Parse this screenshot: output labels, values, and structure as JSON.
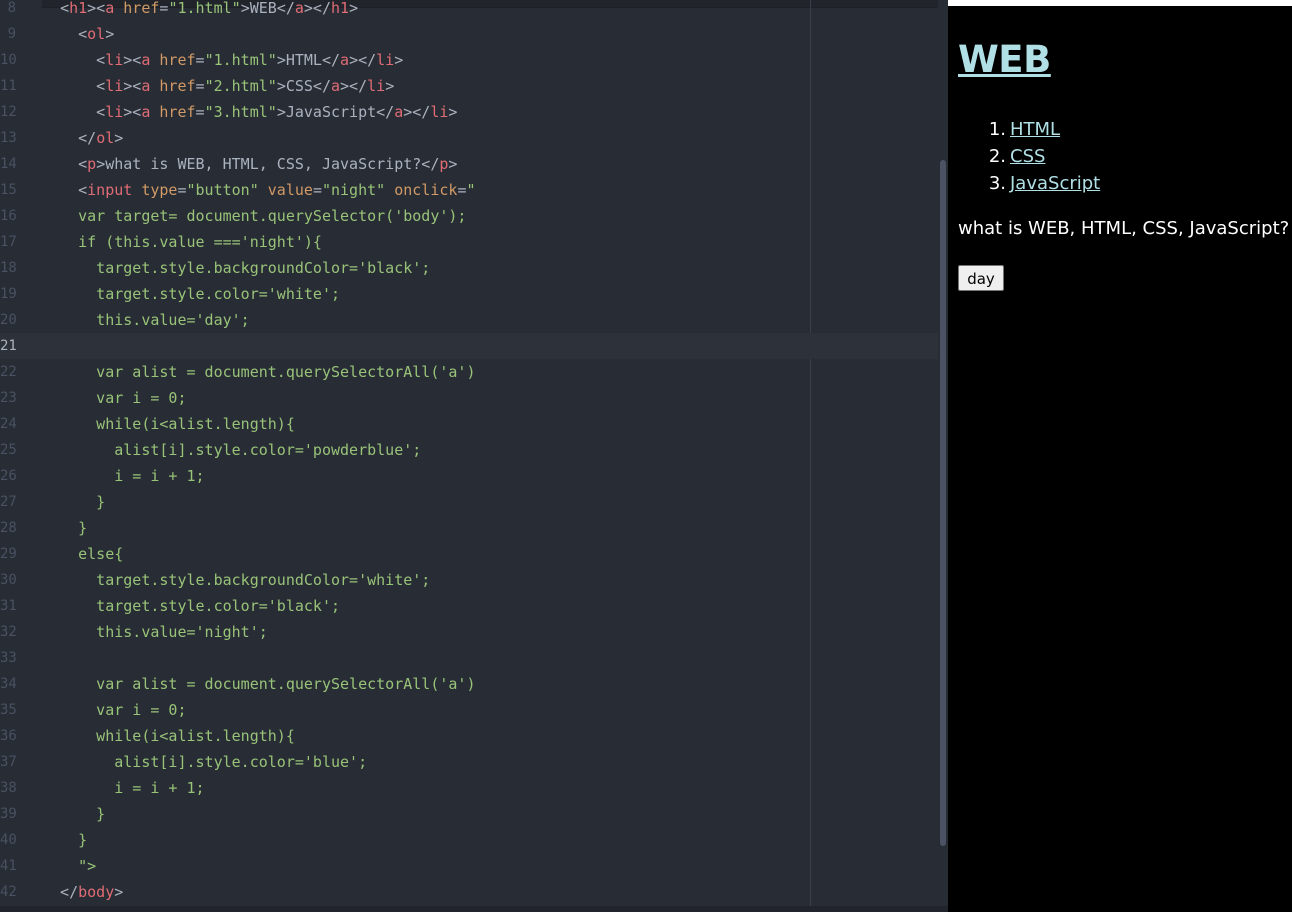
{
  "editor": {
    "lines": [
      {
        "num": "8",
        "parts": [
          {
            "c": "plain",
            "t": "  "
          },
          {
            "c": "plain",
            "t": "<"
          },
          {
            "c": "tag",
            "t": "h1"
          },
          {
            "c": "plain",
            "t": "><"
          },
          {
            "c": "tag",
            "t": "a "
          },
          {
            "c": "attr",
            "t": "href"
          },
          {
            "c": "plain",
            "t": "="
          },
          {
            "c": "str",
            "t": "\"1.html\""
          },
          {
            "c": "plain",
            "t": ">WEB</"
          },
          {
            "c": "tag",
            "t": "a"
          },
          {
            "c": "plain",
            "t": "></"
          },
          {
            "c": "tag",
            "t": "h1"
          },
          {
            "c": "plain",
            "t": ">"
          }
        ]
      },
      {
        "num": "9",
        "parts": [
          {
            "c": "plain",
            "t": "    <"
          },
          {
            "c": "tag",
            "t": "ol"
          },
          {
            "c": "plain",
            "t": ">"
          }
        ]
      },
      {
        "num": "10",
        "parts": [
          {
            "c": "plain",
            "t": "      <"
          },
          {
            "c": "tag",
            "t": "li"
          },
          {
            "c": "plain",
            "t": "><"
          },
          {
            "c": "tag",
            "t": "a "
          },
          {
            "c": "attr",
            "t": "href"
          },
          {
            "c": "plain",
            "t": "="
          },
          {
            "c": "str",
            "t": "\"1.html\""
          },
          {
            "c": "plain",
            "t": ">HTML</"
          },
          {
            "c": "tag",
            "t": "a"
          },
          {
            "c": "plain",
            "t": "></"
          },
          {
            "c": "tag",
            "t": "li"
          },
          {
            "c": "plain",
            "t": ">"
          }
        ]
      },
      {
        "num": "11",
        "parts": [
          {
            "c": "plain",
            "t": "      <"
          },
          {
            "c": "tag",
            "t": "li"
          },
          {
            "c": "plain",
            "t": "><"
          },
          {
            "c": "tag",
            "t": "a "
          },
          {
            "c": "attr",
            "t": "href"
          },
          {
            "c": "plain",
            "t": "="
          },
          {
            "c": "str",
            "t": "\"2.html\""
          },
          {
            "c": "plain",
            "t": ">CSS</"
          },
          {
            "c": "tag",
            "t": "a"
          },
          {
            "c": "plain",
            "t": "></"
          },
          {
            "c": "tag",
            "t": "li"
          },
          {
            "c": "plain",
            "t": ">"
          }
        ]
      },
      {
        "num": "12",
        "parts": [
          {
            "c": "plain",
            "t": "      <"
          },
          {
            "c": "tag",
            "t": "li"
          },
          {
            "c": "plain",
            "t": "><"
          },
          {
            "c": "tag",
            "t": "a "
          },
          {
            "c": "attr",
            "t": "href"
          },
          {
            "c": "plain",
            "t": "="
          },
          {
            "c": "str",
            "t": "\"3.html\""
          },
          {
            "c": "plain",
            "t": ">JavaScript</"
          },
          {
            "c": "tag",
            "t": "a"
          },
          {
            "c": "plain",
            "t": "></"
          },
          {
            "c": "tag",
            "t": "li"
          },
          {
            "c": "plain",
            "t": ">"
          }
        ]
      },
      {
        "num": "13",
        "parts": [
          {
            "c": "plain",
            "t": "    </"
          },
          {
            "c": "tag",
            "t": "ol"
          },
          {
            "c": "plain",
            "t": ">"
          }
        ]
      },
      {
        "num": "14",
        "parts": [
          {
            "c": "plain",
            "t": "    <"
          },
          {
            "c": "tag",
            "t": "p"
          },
          {
            "c": "plain",
            "t": ">what is WEB, HTML, CSS, JavaScript?</"
          },
          {
            "c": "tag",
            "t": "p"
          },
          {
            "c": "plain",
            "t": ">"
          }
        ]
      },
      {
        "num": "15",
        "parts": [
          {
            "c": "plain",
            "t": "    <"
          },
          {
            "c": "tag",
            "t": "input "
          },
          {
            "c": "attr",
            "t": "type"
          },
          {
            "c": "plain",
            "t": "="
          },
          {
            "c": "str",
            "t": "\"button\" "
          },
          {
            "c": "attr",
            "t": "value"
          },
          {
            "c": "plain",
            "t": "="
          },
          {
            "c": "str",
            "t": "\"night\" "
          },
          {
            "c": "attr",
            "t": "onclick"
          },
          {
            "c": "plain",
            "t": "="
          },
          {
            "c": "str",
            "t": "\""
          }
        ]
      },
      {
        "num": "16",
        "parts": [
          {
            "c": "str",
            "t": "    var target= document.querySelector('body');"
          }
        ]
      },
      {
        "num": "17",
        "parts": [
          {
            "c": "str",
            "t": "    if (this.value ==='night'){"
          }
        ]
      },
      {
        "num": "18",
        "parts": [
          {
            "c": "str",
            "t": "      target.style.backgroundColor='black';"
          }
        ]
      },
      {
        "num": "19",
        "parts": [
          {
            "c": "str",
            "t": "      target.style.color='white';"
          }
        ]
      },
      {
        "num": "20",
        "parts": [
          {
            "c": "str",
            "t": "      this.value='day';"
          }
        ]
      },
      {
        "num": "21",
        "parts": [],
        "active": true
      },
      {
        "num": "22",
        "parts": [
          {
            "c": "str",
            "t": "      var alist = document.querySelectorAll('a')"
          }
        ]
      },
      {
        "num": "23",
        "parts": [
          {
            "c": "str",
            "t": "      var i = 0;"
          }
        ]
      },
      {
        "num": "24",
        "parts": [
          {
            "c": "str",
            "t": "      while(i<alist.length){"
          }
        ]
      },
      {
        "num": "25",
        "parts": [
          {
            "c": "str",
            "t": "        alist[i].style.color='powderblue';"
          }
        ]
      },
      {
        "num": "26",
        "parts": [
          {
            "c": "str",
            "t": "        i = i + 1;"
          }
        ]
      },
      {
        "num": "27",
        "parts": [
          {
            "c": "str",
            "t": "      }"
          }
        ]
      },
      {
        "num": "28",
        "parts": [
          {
            "c": "str",
            "t": "    }"
          }
        ]
      },
      {
        "num": "29",
        "parts": [
          {
            "c": "str",
            "t": "    else{"
          }
        ]
      },
      {
        "num": "30",
        "parts": [
          {
            "c": "str",
            "t": "      target.style.backgroundColor='white';"
          }
        ]
      },
      {
        "num": "31",
        "parts": [
          {
            "c": "str",
            "t": "      target.style.color='black';"
          }
        ]
      },
      {
        "num": "32",
        "parts": [
          {
            "c": "str",
            "t": "      this.value='night';"
          }
        ]
      },
      {
        "num": "33",
        "parts": []
      },
      {
        "num": "34",
        "parts": [
          {
            "c": "str",
            "t": "      var alist = document.querySelectorAll('a')"
          }
        ]
      },
      {
        "num": "35",
        "parts": [
          {
            "c": "str",
            "t": "      var i = 0;"
          }
        ]
      },
      {
        "num": "36",
        "parts": [
          {
            "c": "str",
            "t": "      while(i<alist.length){"
          }
        ]
      },
      {
        "num": "37",
        "parts": [
          {
            "c": "str",
            "t": "        alist[i].style.color='blue';"
          }
        ]
      },
      {
        "num": "38",
        "parts": [
          {
            "c": "str",
            "t": "        i = i + 1;"
          }
        ]
      },
      {
        "num": "39",
        "parts": [
          {
            "c": "str",
            "t": "      }"
          }
        ]
      },
      {
        "num": "40",
        "parts": [
          {
            "c": "str",
            "t": "    }"
          }
        ]
      },
      {
        "num": "41",
        "parts": [
          {
            "c": "str",
            "t": "    \">"
          }
        ]
      },
      {
        "num": "42",
        "parts": [
          {
            "c": "plain",
            "t": "  </"
          },
          {
            "c": "tag",
            "t": "body"
          },
          {
            "c": "plain",
            "t": ">"
          }
        ]
      }
    ]
  },
  "preview": {
    "title": "WEB",
    "links": [
      {
        "num": "1.",
        "label": "HTML"
      },
      {
        "num": "2.",
        "label": "CSS"
      },
      {
        "num": "3.",
        "label": "JavaScript"
      }
    ],
    "paragraph": "what is WEB, HTML, CSS, JavaScript?",
    "button_label": "day"
  },
  "colors": {
    "editor_bg": "#282c34",
    "tag": "#e06c75",
    "attribute": "#d19a66",
    "string": "#98c379",
    "preview_bg": "#000000",
    "link": "#b0e0e6"
  }
}
